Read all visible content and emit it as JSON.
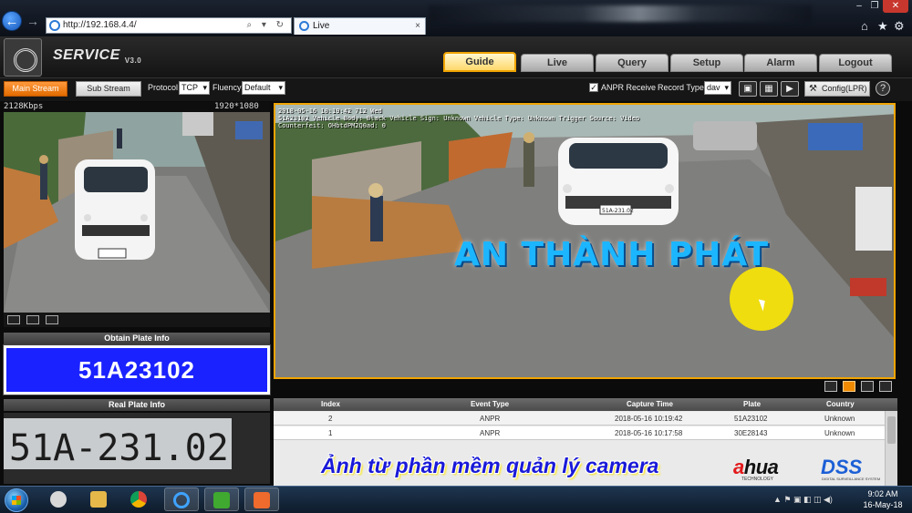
{
  "browser": {
    "address": "http://192.168.4.4/",
    "tab_title": "Live",
    "tab_close": "×",
    "addr_tools": "⌕ ▾ ↻",
    "win_controls": [
      "–",
      "❐",
      "✕"
    ],
    "toolbar_icons": [
      "⌂",
      "★",
      "⚙"
    ]
  },
  "app": {
    "title": "SERVICE",
    "version": "V3.0",
    "nav_tabs": [
      "Guide",
      "Live",
      "Query",
      "Setup",
      "Alarm",
      "Logout"
    ],
    "active_tab": "Guide"
  },
  "toolbar": {
    "main_stream": "Main Stream",
    "sub_stream": "Sub Stream",
    "protocol_label": "Protocol",
    "protocol_value": "TCP",
    "fluency_label": "Fluency",
    "fluency_value": "Default",
    "anpr_checked": "✓",
    "anpr_label": "ANPR Receive",
    "record_type_label": "Record Type",
    "record_type_value": "dav",
    "config_label": "Config(LPR)",
    "help": "?"
  },
  "left_preview": {
    "bitrate": "2128Kbps",
    "resolution": "1920*1080"
  },
  "plate": {
    "obtain_header": "Obtain Plate Info",
    "obtain_value": "51A23102",
    "real_header": "Real Plate Info",
    "real_value": "51A-231.02"
  },
  "main_view": {
    "overlay_line1": "2018-05-16 10:19:42 712 Wed",
    "overlay_line2": "51A23102 Vehicle Body: Black Vehicle Sign: Unknown Vehicle Type: Unknown Trigger Source: Video",
    "overlay_line3": "Counterfeit: OHbtdPM2Q0ad: 0",
    "small_plate": "51A-231.02",
    "brand_text": "AN THÀNH PHÁT"
  },
  "events": {
    "headers": [
      "Index",
      "Event Type",
      "Capture Time",
      "Plate",
      "Country"
    ],
    "rows": [
      {
        "index": "2",
        "type": "ANPR",
        "time": "2018-05-16 10:19:42",
        "plate": "51A23102",
        "country": "Unknown"
      },
      {
        "index": "1",
        "type": "ANPR",
        "time": "2018-05-16 10:17:58",
        "plate": "30E28143",
        "country": "Unknown"
      }
    ]
  },
  "caption": "Ảnh từ phần mềm quản lý camera",
  "logos": {
    "dahua_a": "a",
    "dahua_rest": "hua",
    "dahua_sub": "TECHNOLOGY",
    "dss": "DSS",
    "dss_sub": "DIGITAL SURVEILLANCE SYSTEM"
  },
  "taskbar": {
    "time": "9:02 AM",
    "date": "16-May-18",
    "tray": "▲ ⚑ ▣ ◧ ◫ ◀)"
  },
  "colors": {
    "accent_orange": "#f0a400",
    "plate_blue": "#1a22ff",
    "brand_cyan": "#1bb6ff",
    "caption_blue": "#1a1ad8"
  }
}
